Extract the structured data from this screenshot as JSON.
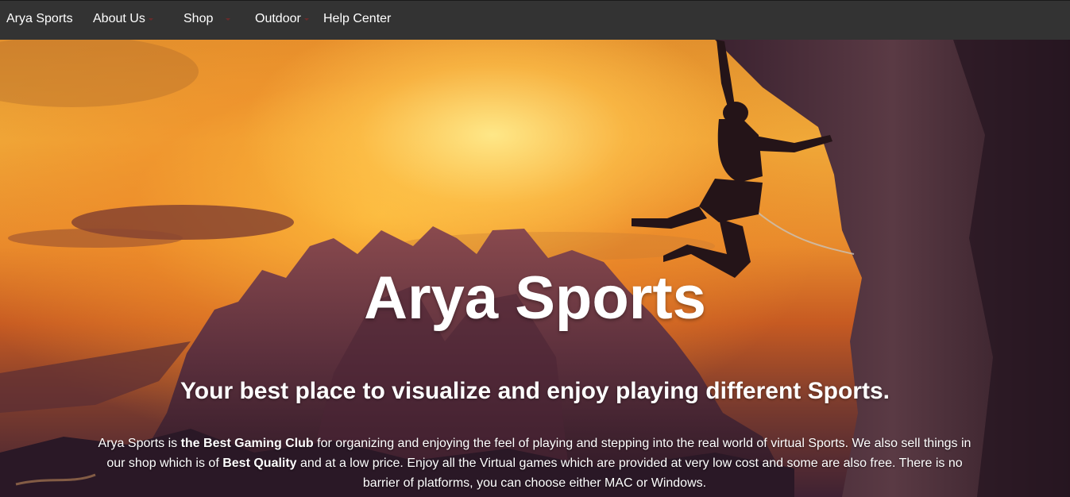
{
  "nav": {
    "brand": "Arya Sports",
    "items": [
      {
        "label": "About Us"
      },
      {
        "label": "Shop"
      },
      {
        "label": "Outdoor"
      },
      {
        "label": "Help Center"
      }
    ]
  },
  "hero": {
    "title": "Arya Sports",
    "subtitle": "Your best place to visualize and enjoy playing different Sports.",
    "description": {
      "part1": "Arya Sports is ",
      "bold1": "the Best Gaming Club",
      "part2": " for organizing and enjoying the feel of playing and stepping into the real world of virtual Sports. We also sell things in our shop which is of ",
      "bold2": "Best Quality",
      "part3": " and at a low price. Enjoy all the Virtual games which are provided at very low cost and some are also free. There is no barrier of platforms, you can choose either MAC or Windows."
    }
  },
  "colors": {
    "navbar": "#333333",
    "text": "#ffffff"
  }
}
